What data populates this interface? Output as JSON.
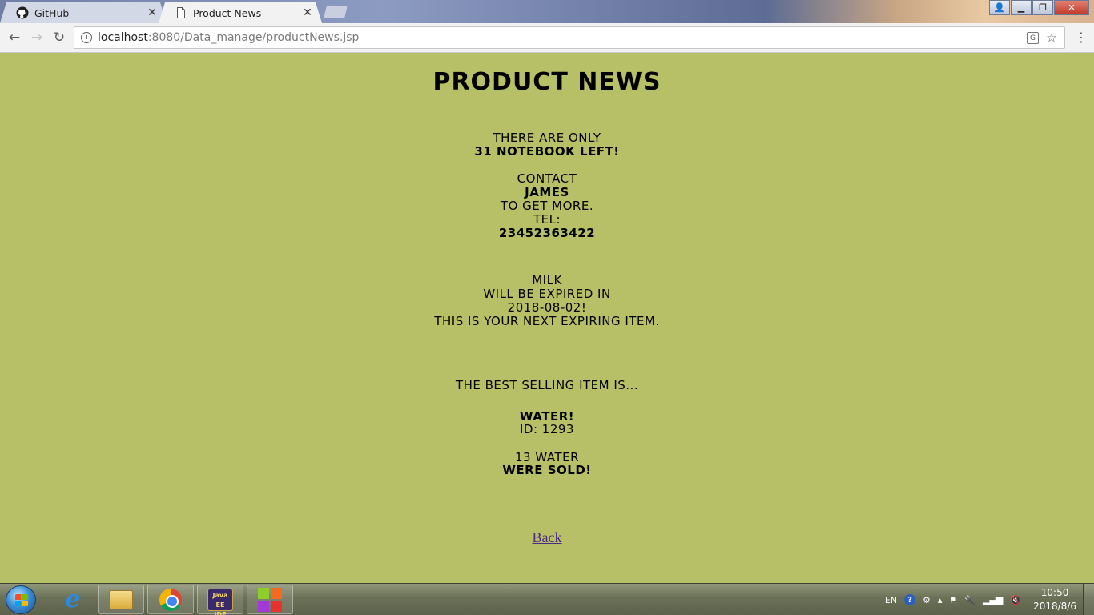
{
  "browser": {
    "tabs": [
      {
        "title": "GitHub",
        "close": "✕"
      },
      {
        "title": "Product News",
        "close": "✕"
      }
    ],
    "url_host": "localhost",
    "url_path": ":8080/Data_manage/productNews.jsp"
  },
  "page": {
    "title": "Product News",
    "stock_notice": {
      "line1": "There are only",
      "line2": "31 notebook left!"
    },
    "contact": {
      "line1": "Contact",
      "name": "James",
      "line3": "to get more.",
      "tel_label": "Tel:",
      "tel": "23452363422"
    },
    "expiry": {
      "item": "Milk",
      "line2": "will be expired in",
      "date": "2018-08-02!",
      "line4": "This is your next expiring item."
    },
    "best_seller": {
      "line1": "The best selling item is...",
      "item": "Water!",
      "id": "ID: 1293",
      "sold_line1": "13 Water",
      "sold_line2": "were sold!"
    },
    "back_link": "Back"
  },
  "taskbar": {
    "lang": "EN",
    "time": "10:50",
    "date": "2018/8/6"
  }
}
